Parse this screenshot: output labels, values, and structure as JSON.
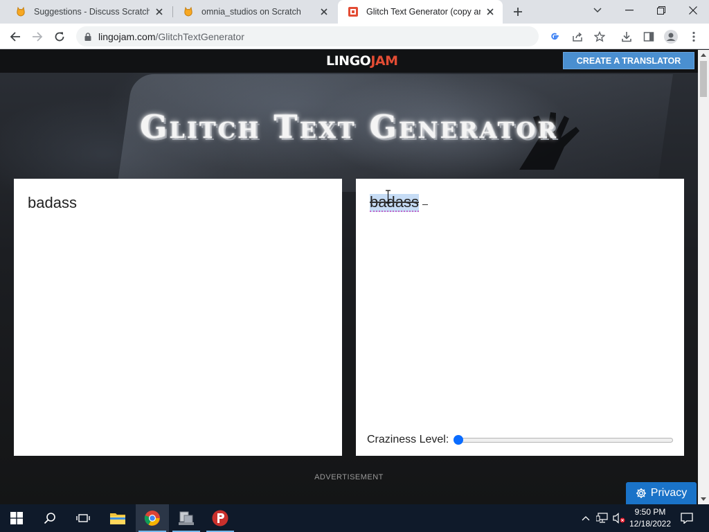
{
  "browser": {
    "tabs": [
      {
        "title": "Suggestions - Discuss Scratch",
        "favicon": "scratch-cat-icon",
        "active": false
      },
      {
        "title": "omnia_studios on Scratch",
        "favicon": "scratch-cat-icon",
        "active": false
      },
      {
        "title": "Glitch Text Generator (copy and p",
        "favicon": "lingojam-icon",
        "active": true
      }
    ],
    "url_host": "lingojam.com",
    "url_path": "/GlitchTextGenerator"
  },
  "site": {
    "logo_part1": "LINGO",
    "logo_part2": "JAM",
    "cta_label": "CREATE A TRANSLATOR",
    "headline": "Glitch Text Generator",
    "input_text": "badass",
    "output_text": "badass",
    "craziness_label": "Craziness Level:",
    "craziness_level": 0,
    "advertisement_label": "ADVERTISEMENT",
    "privacy_label": "Privacy"
  },
  "taskbar": {
    "apps": [
      "windows-start-icon",
      "search-icon",
      "task-view-icon",
      "file-explorer-icon",
      "chrome-icon",
      "network-app-icon",
      "psiphon-icon"
    ],
    "time": "9:50 PM",
    "date": "12/18/2022"
  },
  "colors": {
    "cta": "#4a8fd0",
    "logo_accent": "#e34c34",
    "privacy": "#1a73c8",
    "slider_thumb": "#0a6cff"
  }
}
